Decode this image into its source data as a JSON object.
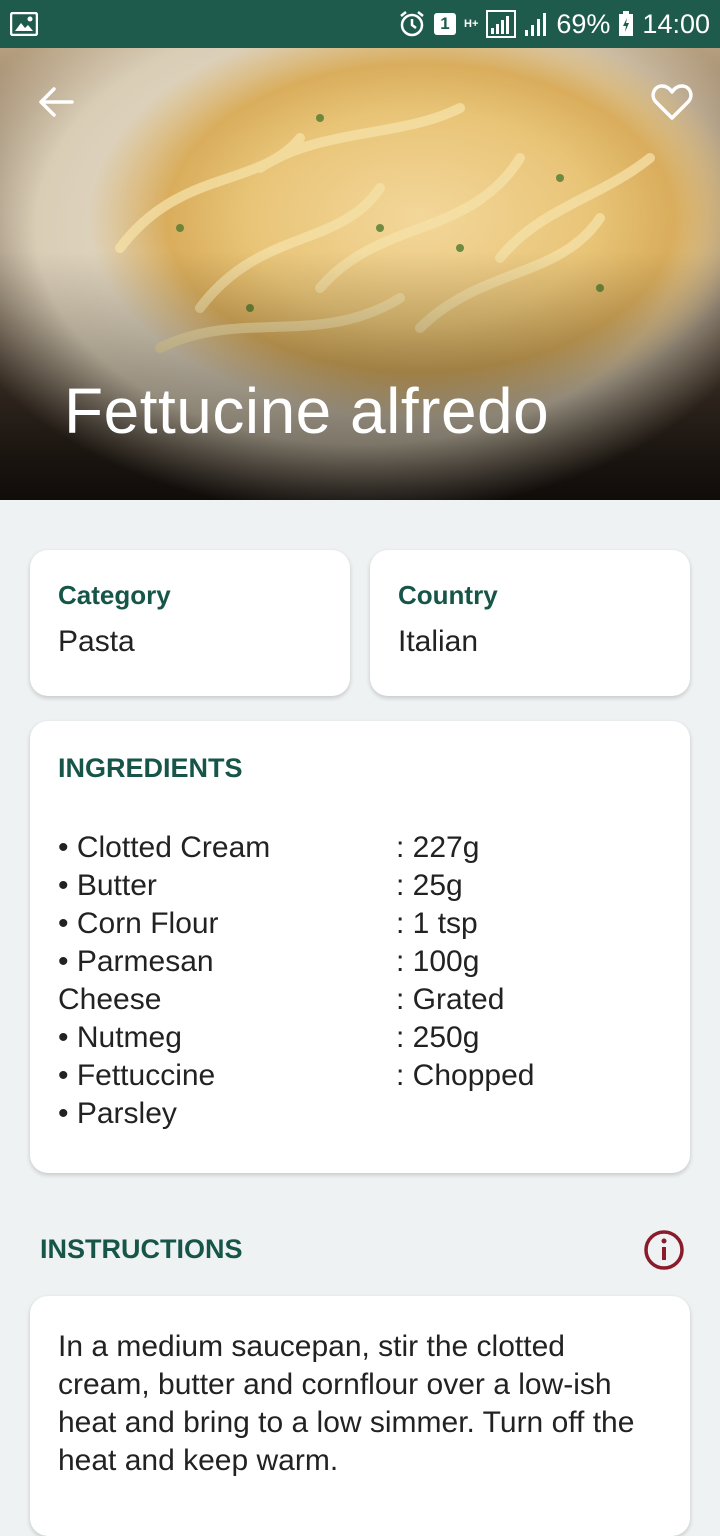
{
  "status_bar": {
    "icons": [
      "image-icon",
      "alarm-icon",
      "sim-badge",
      "network-h-plus-icon",
      "signal-icon",
      "signal-icon-2",
      "battery-icon"
    ],
    "sim_number": "1",
    "network_type": "H+",
    "battery_percent": "69%",
    "time": "14:00"
  },
  "hero": {
    "title": "Fettucine alfredo",
    "back_icon": "arrow-back-icon",
    "favorite_icon": "heart-outline-icon"
  },
  "info": {
    "category_label": "Category",
    "category_value": "Pasta",
    "country_label": "Country",
    "country_value": "Italian"
  },
  "ingredients": {
    "title": "INGREDIENTS",
    "names": [
      "• Clotted Cream",
      "• Butter",
      "• Corn Flour",
      "• Parmesan",
      "Cheese",
      "• Nutmeg",
      "• Fettuccine",
      "• Parsley"
    ],
    "quantities": [
      ": 227g",
      ": 25g",
      ": 1 tsp",
      ": 100g",
      ": Grated",
      ": 250g",
      ": Chopped"
    ]
  },
  "instructions": {
    "title": "INSTRUCTIONS",
    "info_icon": "info-icon",
    "text": "In a medium saucepan, stir the clotted cream, butter and cornflour over a low-ish heat and bring to a low simmer. Turn off the heat and keep warm."
  },
  "colors": {
    "status_bar": "#1f5b4c",
    "accent": "#165548",
    "info_icon": "#8b1a2b",
    "background": "#eef2f3"
  }
}
